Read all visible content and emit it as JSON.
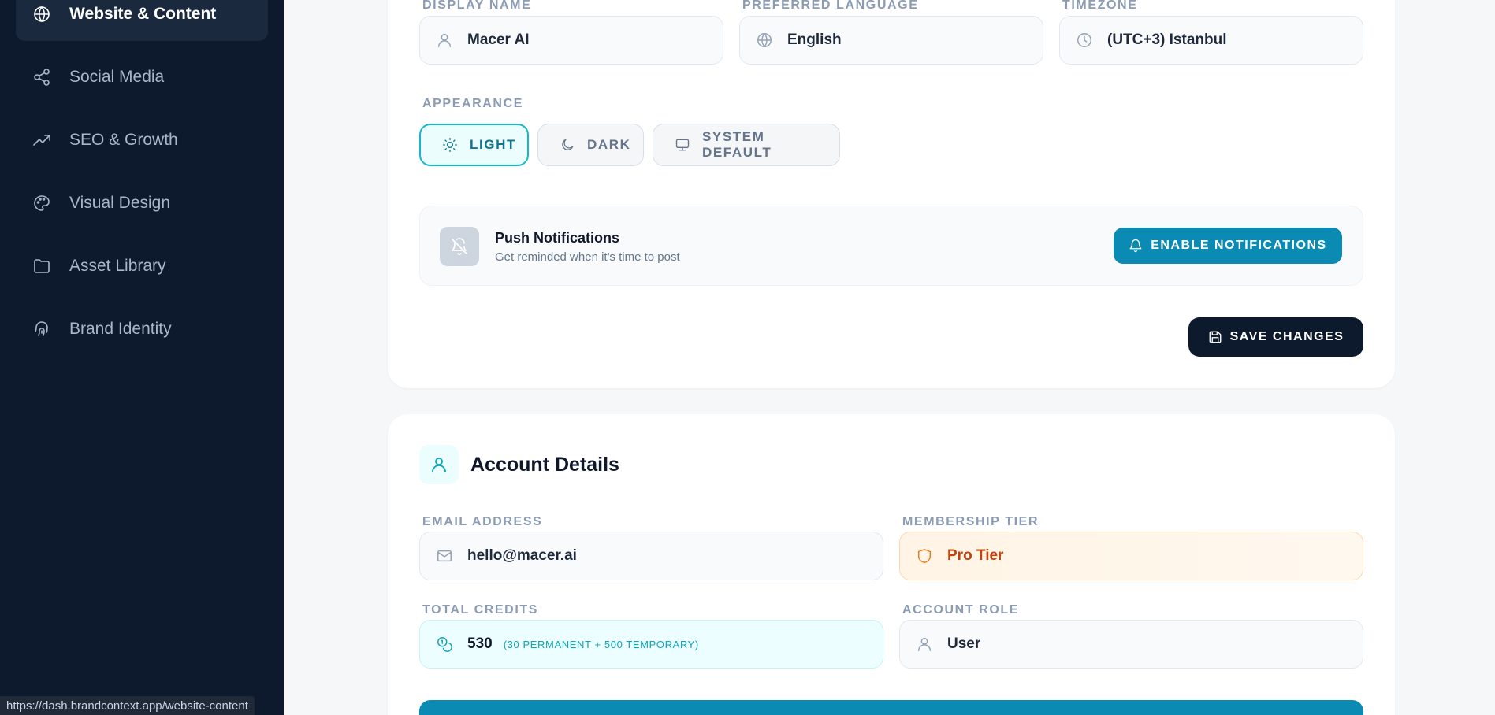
{
  "sidebar": {
    "items": [
      {
        "label": "Website & Content",
        "icon": "globe-icon",
        "active": true
      },
      {
        "label": "Social Media",
        "icon": "share-icon",
        "active": false
      },
      {
        "label": "SEO & Growth",
        "icon": "trending-up-icon",
        "active": false
      },
      {
        "label": "Visual Design",
        "icon": "palette-icon",
        "active": false
      },
      {
        "label": "Asset Library",
        "icon": "folder-icon",
        "active": false
      },
      {
        "label": "Brand Identity",
        "icon": "fingerprint-icon",
        "active": false
      }
    ]
  },
  "preferences": {
    "display_name": {
      "label": "DISPLAY NAME",
      "value": "Macer AI"
    },
    "language": {
      "label": "PREFERRED LANGUAGE",
      "value": "English"
    },
    "timezone": {
      "label": "TIMEZONE",
      "value": "(UTC+3) Istanbul"
    },
    "appearance": {
      "label": "APPEARANCE",
      "options": [
        {
          "label": "LIGHT",
          "icon": "sun-icon",
          "selected": true
        },
        {
          "label": "DARK",
          "icon": "moon-icon",
          "selected": false
        },
        {
          "label": "SYSTEM DEFAULT",
          "icon": "monitor-icon",
          "selected": false
        }
      ]
    },
    "notifications": {
      "title": "Push Notifications",
      "subtitle": "Get reminded when it's time to post",
      "button": "ENABLE NOTIFICATIONS"
    },
    "save_button": "SAVE CHANGES"
  },
  "account": {
    "title": "Account Details",
    "email": {
      "label": "EMAIL ADDRESS",
      "value": "hello@macer.ai"
    },
    "tier": {
      "label": "MEMBERSHIP TIER",
      "value": "Pro Tier"
    },
    "credits": {
      "label": "TOTAL CREDITS",
      "value": "530",
      "breakdown": "(30 PERMANENT + 500 TEMPORARY)"
    },
    "role": {
      "label": "ACCOUNT ROLE",
      "value": "User"
    }
  },
  "status_url": "https://dash.brandcontext.app/website-content",
  "colors": {
    "sidebar_bg": "#0d1a2e",
    "accent": "#0b8bb4",
    "teal": "#14b8c6",
    "tier_orange": "#c2410c"
  }
}
